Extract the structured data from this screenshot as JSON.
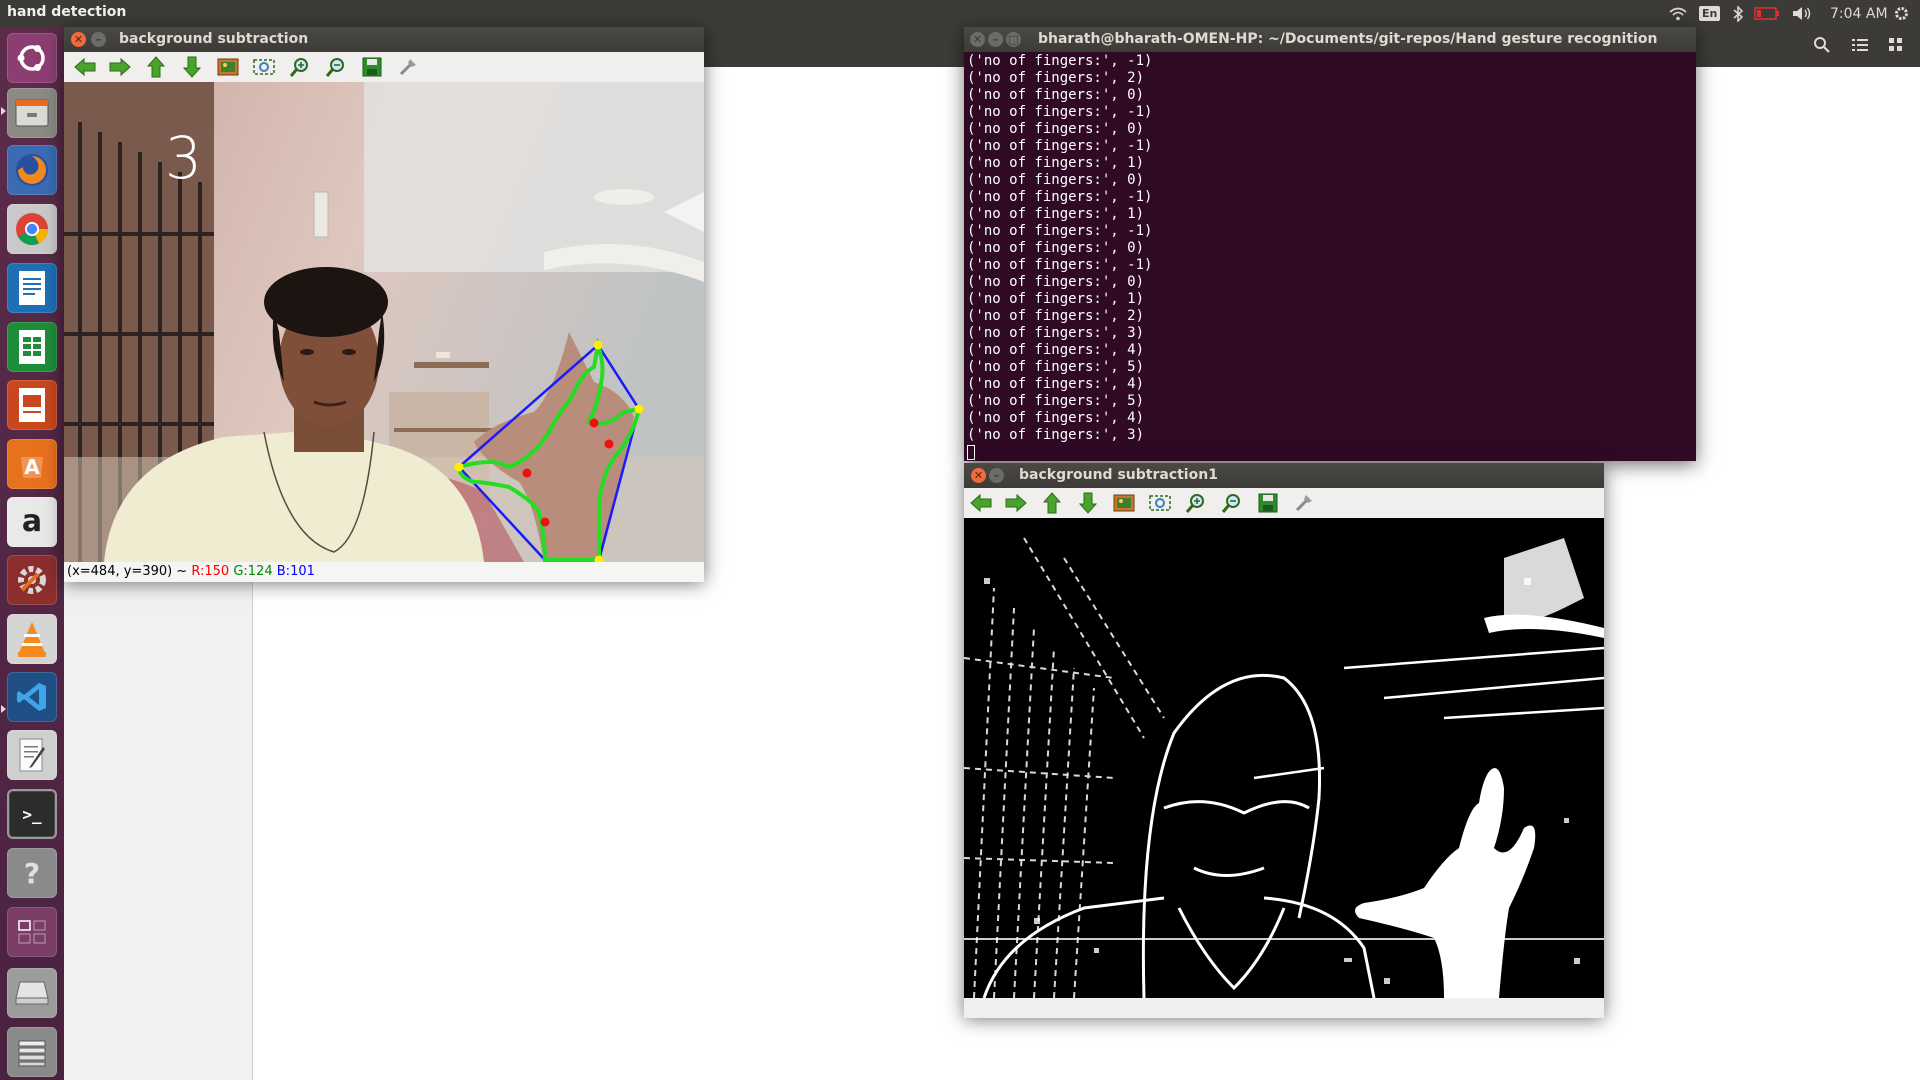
{
  "topbar": {
    "app_title": "hand detection",
    "keyboard_layout": "En",
    "time": "7:04 AM",
    "icons": [
      "wifi-icon",
      "bluetooth-icon",
      "battery-icon",
      "volume-icon",
      "settings-gear-icon"
    ]
  },
  "launcher": {
    "items": [
      "ubuntu-dash",
      "files",
      "firefox",
      "chrome",
      "writer",
      "calc",
      "impress",
      "software-center",
      "amazon",
      "system-settings",
      "vlc",
      "vscode",
      "text-editor",
      "terminal",
      "help",
      "workspace-switcher",
      "drive",
      "trash"
    ],
    "amazon_glyph": "a",
    "help_glyph": "?",
    "terminal_glyph": ">_"
  },
  "window_main": {
    "title": "background subtraction",
    "overlay_count": "3",
    "status_prefix": "(x=484, y=390) ~ ",
    "status_r": "R:150",
    "status_g": "G:124",
    "status_b": "B:101",
    "toolbar_icons": [
      "arrow-left-icon",
      "arrow-right-icon",
      "arrow-up-icon",
      "arrow-down-icon",
      "image-icon",
      "zoom-fit-icon",
      "zoom-in-icon",
      "zoom-out-icon",
      "save-icon",
      "properties-icon"
    ]
  },
  "window_mask": {
    "title": "background subtraction1"
  },
  "terminal": {
    "title": "bharath@bharath-OMEN-HP: ~/Documents/git-repos/Hand gesture recognition",
    "lines": [
      "('no of fingers:', -1)",
      "('no of fingers:', 2)",
      "('no of fingers:', 0)",
      "('no of fingers:', -1)",
      "('no of fingers:', 0)",
      "('no of fingers:', -1)",
      "('no of fingers:', 1)",
      "('no of fingers:', 0)",
      "('no of fingers:', -1)",
      "('no of fingers:', 1)",
      "('no of fingers:', -1)",
      "('no of fingers:', 0)",
      "('no of fingers:', -1)",
      "('no of fingers:', 0)",
      "('no of fingers:', 1)",
      "('no of fingers:', 2)",
      "('no of fingers:', 3)",
      "('no of fingers:', 4)",
      "('no of fingers:', 5)",
      "('no of fingers:', 4)",
      "('no of fingers:', 5)",
      "('no of fingers:', 4)",
      "('no of fingers:', 3)"
    ]
  },
  "colors": {
    "terminal_bg": "#300a24",
    "hull": "#1a1aff",
    "contour": "#22dd22",
    "hull_point": "#ffee00",
    "defect_point": "#ee1111",
    "status_r": "#ff0000",
    "status_g": "#008800",
    "status_b": "#0000ff"
  }
}
